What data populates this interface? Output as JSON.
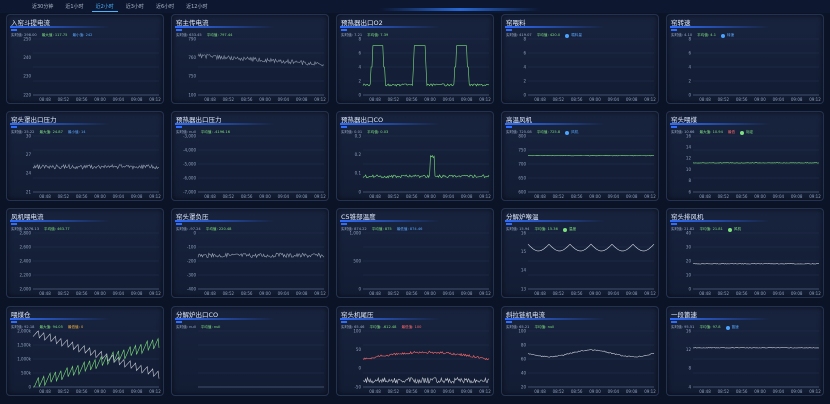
{
  "tabs": [
    "近30分钟",
    "近1小时",
    "近2小时",
    "近3小时",
    "近6小时",
    "近12小时"
  ],
  "active_tab": 2,
  "times": [
    "08:48",
    "08:52",
    "08:56",
    "09:00",
    "09:04",
    "09:08",
    "09:12"
  ],
  "panels": [
    {
      "title": "入窑斗提电流",
      "stats": [
        {
          "t": "实时值: 298.00",
          "c": ""
        },
        {
          "t": "最大值: 117.75",
          "c": "g"
        },
        {
          "t": "最小值: 242",
          "c": "b"
        }
      ],
      "y": [
        "250",
        "240",
        "230",
        "220"
      ],
      "series": []
    },
    {
      "title": "窑主传电流",
      "stats": [
        {
          "t": "实时值: 633.45",
          "c": ""
        },
        {
          "t": "平均值: 797.44",
          "c": "g"
        }
      ],
      "y": [
        "790",
        "760",
        "750",
        "100"
      ],
      "series": [
        {
          "kind": "noisy-down",
          "color": "#8a96aa"
        }
      ]
    },
    {
      "title": "预热器出口O2",
      "stats": [
        {
          "t": "实时值: 7.21",
          "c": ""
        },
        {
          "t": "平均值: 7.39",
          "c": "g"
        }
      ],
      "y": [
        "8",
        "6",
        "4",
        "2",
        "0"
      ],
      "series": [
        {
          "kind": "pulses",
          "color": "#7ee07e"
        }
      ]
    },
    {
      "title": "窑喂料",
      "stats": [
        {
          "t": "实时值: 419.07",
          "c": ""
        },
        {
          "t": "平均值: 420.0",
          "c": "g"
        },
        {
          "t": "喂料量",
          "c": "leg"
        }
      ],
      "y": [
        "8",
        "6",
        "4",
        "2",
        "0"
      ],
      "series": []
    },
    {
      "title": "窑转速",
      "stats": [
        {
          "t": "实时值: 4.10",
          "c": ""
        },
        {
          "t": "平均值: 4.1",
          "c": "g"
        },
        {
          "t": "转速",
          "c": "leg"
        }
      ],
      "y": [
        "8",
        "6",
        "4",
        "2",
        "0"
      ],
      "series": []
    },
    {
      "title": "窑头罩出口压力",
      "stats": [
        {
          "t": "实时值: 25.22",
          "c": ""
        },
        {
          "t": "最大值: 24.87",
          "c": "g"
        },
        {
          "t": "最小值: 14",
          "c": "b"
        }
      ],
      "y": [
        "30",
        "27",
        "24",
        "21"
      ],
      "series": [
        {
          "kind": "flat-noise",
          "color": "#9aa4b4",
          "level": 0.55
        }
      ]
    },
    {
      "title": "预热器出口压力",
      "stats": [
        {
          "t": "实时值: null",
          "c": ""
        },
        {
          "t": "平均值: -4196.16",
          "c": "g"
        }
      ],
      "y": [
        "-3,000",
        "-4,000",
        "-5,000",
        "-6,000",
        "-7,000"
      ],
      "series": []
    },
    {
      "title": "预热器出口CO",
      "stats": [
        {
          "t": "实时值: 0.01",
          "c": ""
        },
        {
          "t": "平均值: 0.03",
          "c": "g"
        }
      ],
      "y": [
        "0.3",
        "0.2",
        "0.1",
        "0"
      ],
      "series": [
        {
          "kind": "spike",
          "color": "#7ee07e"
        }
      ]
    },
    {
      "title": "高温风机",
      "stats": [
        {
          "t": "实时值: 725.08",
          "c": ""
        },
        {
          "t": "平均值: 725.8",
          "c": "g"
        },
        {
          "t": "风机",
          "c": "leg"
        }
      ],
      "y": [
        "800",
        "750",
        "700",
        "650",
        "600"
      ],
      "series": [
        {
          "kind": "flat",
          "color": "#7ee07e",
          "level": 0.35
        }
      ]
    },
    {
      "title": "窑头喂煤",
      "stats": [
        {
          "t": "实时值: 10.66",
          "c": ""
        },
        {
          "t": "最大值: 10.94",
          "c": "g"
        },
        {
          "t": "最低",
          "c": "r"
        },
        {
          "t": "标定",
          "c": "leg-g"
        }
      ],
      "y": [
        "16",
        "14",
        "12",
        "10",
        "8",
        "6"
      ],
      "series": [
        {
          "kind": "flat",
          "color": "#7ee07e",
          "level": 0.48
        }
      ]
    },
    {
      "title": "风机喂电流",
      "stats": [
        {
          "t": "实时值: 3076.13",
          "c": ""
        },
        {
          "t": "平均值: 463.77",
          "c": "g"
        }
      ],
      "y": [
        "2,800",
        "2,600",
        "2,400",
        "2,200",
        "2,000"
      ],
      "series": []
    },
    {
      "title": "窑头罩负压",
      "stats": [
        {
          "t": "实时值: -97.24",
          "c": ""
        },
        {
          "t": "平均值: 220.48",
          "c": "g"
        }
      ],
      "y": [
        "0",
        "-100",
        "-200",
        "-300",
        "-400"
      ],
      "series": [
        {
          "kind": "flat-noise",
          "color": "#9aa4b4",
          "level": 0.4
        }
      ]
    },
    {
      "title": "C5锥部温度",
      "stats": [
        {
          "t": "实时值: 874.22",
          "c": ""
        },
        {
          "t": "平均值: 875",
          "c": "g"
        },
        {
          "t": "最低值: 874.46",
          "c": "b"
        }
      ],
      "y": [
        "1,000",
        "500",
        "0"
      ],
      "series": []
    },
    {
      "title": "分解炉喉温",
      "stats": [
        {
          "t": "实时值: 15.94",
          "c": ""
        },
        {
          "t": "平均值: 15.36",
          "c": "g"
        },
        {
          "t": "温度",
          "c": "leg-g"
        }
      ],
      "y": [
        "16",
        "15",
        "14",
        "13"
      ],
      "series": [
        {
          "kind": "waves",
          "color": "#d8dde8"
        }
      ]
    },
    {
      "title": "窑头排风机",
      "stats": [
        {
          "t": "实时值: 21.82",
          "c": ""
        },
        {
          "t": "平均值: 21.81",
          "c": "g"
        },
        {
          "t": "风机",
          "c": "leg-g"
        }
      ],
      "y": [
        "40",
        "30",
        "20",
        "10",
        "0"
      ],
      "series": [
        {
          "kind": "flat",
          "color": "#c7ccd6",
          "level": 0.55
        }
      ]
    },
    {
      "title": "喂煤仓",
      "stats": [
        {
          "t": "实时值: 92.18",
          "c": ""
        },
        {
          "t": "最大值: 94.05",
          "c": "g"
        },
        {
          "t": "最低值: 0",
          "c": "o"
        }
      ],
      "y": [
        "2,000k",
        "1,500k",
        "1,000k",
        "500k",
        "0"
      ],
      "series": [
        {
          "kind": "saw-up",
          "color": "#7ee07e"
        },
        {
          "kind": "saw-down",
          "color": "#c7ccd6"
        }
      ]
    },
    {
      "title": "分解炉出口CO",
      "stats": [
        {
          "t": "实时值: null",
          "c": ""
        },
        {
          "t": "平均值: null",
          "c": "g"
        }
      ],
      "y": [],
      "series": []
    },
    {
      "title": "窑头机尾压",
      "stats": [
        {
          "t": "实时值: 65.46",
          "c": ""
        },
        {
          "t": "平均值: -612.48",
          "c": "g"
        },
        {
          "t": "最低值: 100",
          "c": "r"
        }
      ],
      "y": [
        "100",
        "50",
        "0",
        "-50"
      ],
      "series": [
        {
          "kind": "arch",
          "color": "#ff6a6a"
        },
        {
          "kind": "noise-low",
          "color": "#c7ccd6"
        }
      ]
    },
    {
      "title": "斜拉链机电流",
      "stats": [
        {
          "t": "实时值: 65.21",
          "c": ""
        },
        {
          "t": "平均值: null",
          "c": "g"
        }
      ],
      "y": [
        "100",
        "80",
        "60",
        "40",
        "20"
      ],
      "series": [
        {
          "kind": "waves-soft",
          "color": "#c7ccd6"
        }
      ]
    },
    {
      "title": "一段篦速",
      "stats": [
        {
          "t": "实时值: 95.51",
          "c": ""
        },
        {
          "t": "平均值: 97.8",
          "c": "g"
        },
        {
          "t": "篦速",
          "c": "leg"
        }
      ],
      "y": [
        "16",
        "12",
        "8",
        "4"
      ],
      "series": [
        {
          "kind": "flat",
          "color": "#c7ccd6",
          "level": 0.3
        }
      ]
    }
  ]
}
